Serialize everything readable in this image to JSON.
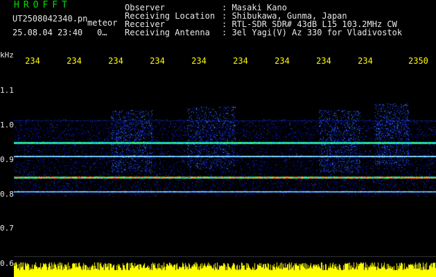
{
  "header": {
    "brand": "HROFFT",
    "file_name": "UT2508042340.pn",
    "mode": "meteor",
    "date_time": "25.08.04 23:40",
    "date_time_trail": "0…",
    "fields": [
      {
        "label": "Observer",
        "value": ": Masaki Kano"
      },
      {
        "label": "Receiving Location",
        "value": ": Shibukawa, Gunma, Japan"
      },
      {
        "label": "Receiver",
        "value": ": RTL-SDR SDR# 43dB L15 103.2MHz CW"
      },
      {
        "label": "Receiving Antenna",
        "value": ": 3el Yagi(V) Az 330 for Vladivostok"
      }
    ]
  },
  "plot": {
    "unit_label": "kHz",
    "time_ticks": [
      "234",
      "234",
      "234",
      "234",
      "234",
      "234",
      "234",
      "234",
      "234",
      "2350"
    ],
    "freq_ticks": [
      "1.1",
      "1.0",
      "0.9",
      "0.8",
      "0.7",
      "0.6"
    ],
    "colors": {
      "background": "#000000",
      "signal_low": "#0000c8",
      "signal_mid": "#00e0e0",
      "signal_high": "#ff2000",
      "yellow_trace": "#ffff00",
      "tick_text": "#ffff00"
    }
  }
}
